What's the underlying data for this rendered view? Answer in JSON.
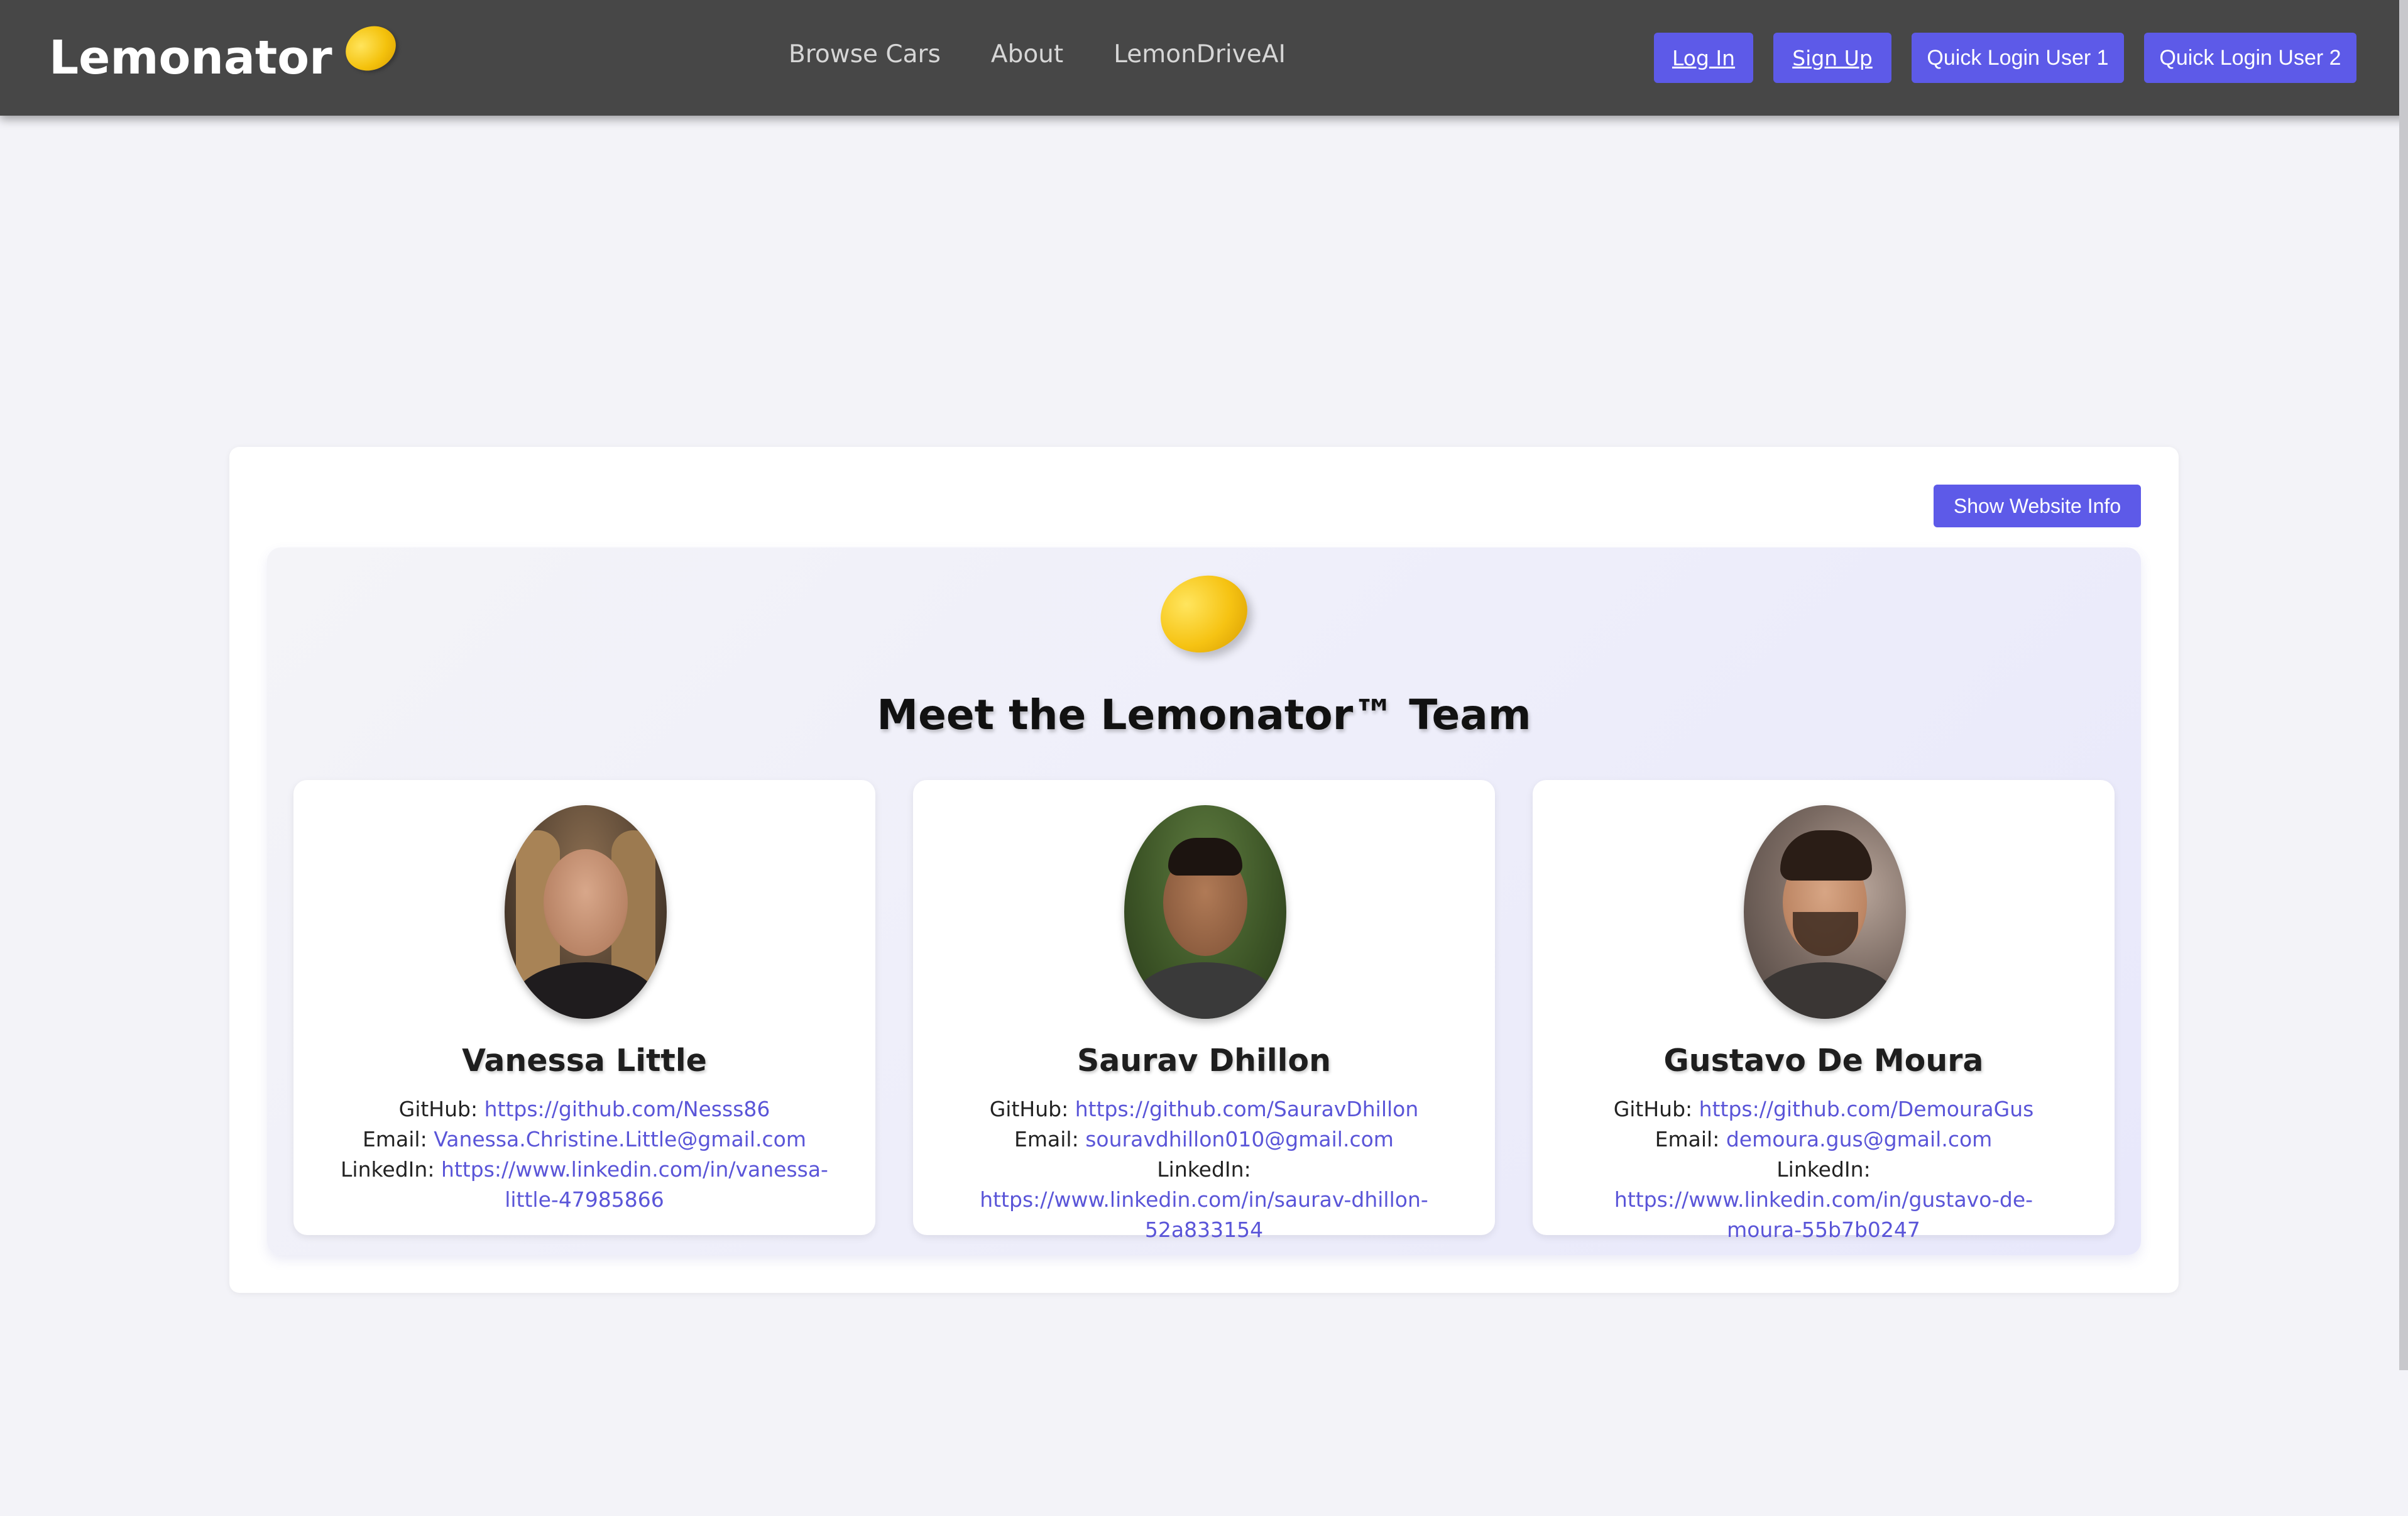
{
  "header": {
    "brand": "Lemonator",
    "nav": [
      "Browse Cars",
      "About",
      "LemonDriveAI"
    ],
    "login_label": "Log In",
    "signup_label": "Sign Up",
    "quick_login_1": "Quick Login User 1",
    "quick_login_2": "Quick Login User 2"
  },
  "main": {
    "info_button": "Show Website Info",
    "team_title": "Meet the Lemonator™ Team",
    "labels": {
      "github": "GitHub:",
      "email": "Email:",
      "linkedin": "LinkedIn:"
    },
    "members": [
      {
        "name": "Vanessa Little",
        "github": "https://github.com/Nesss86",
        "email": "Vanessa.Christine.Little@gmail.com",
        "linkedin": "https://www.linkedin.com/in/vanessa-little-47985866"
      },
      {
        "name": "Saurav Dhillon",
        "github": "https://github.com/SauravDhillon",
        "email": "souravdhillon010@gmail.com",
        "linkedin": "https://www.linkedin.com/in/saurav-dhillon-52a833154"
      },
      {
        "name": "Gustavo De Moura",
        "github": "https://github.com/DemouraGus",
        "email": "demoura.gus@gmail.com",
        "linkedin": "https://www.linkedin.com/in/gustavo-de-moura-55b7b0247"
      }
    ]
  },
  "colors": {
    "header_bg": "#474747",
    "accent": "#5d5ae8",
    "link": "#5a55d8",
    "page_bg": "#f3f3f8",
    "lemon": "#f4c20d"
  }
}
